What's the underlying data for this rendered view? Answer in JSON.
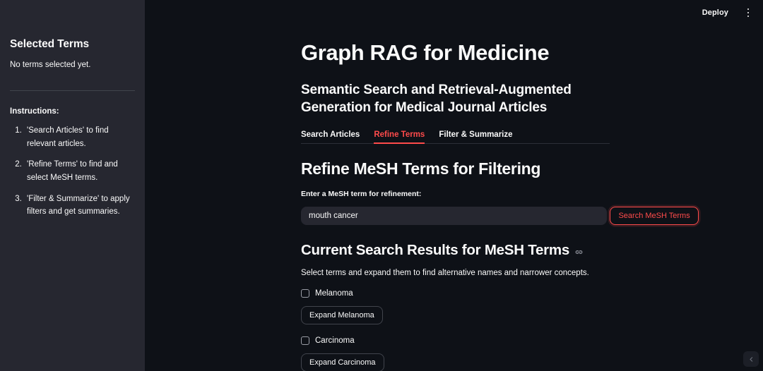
{
  "toolbar": {
    "deploy_label": "Deploy",
    "menu_icon": "kebab-menu-icon"
  },
  "sidebar": {
    "title": "Selected Terms",
    "empty_state": "No terms selected yet.",
    "instructions_title": "Instructions:",
    "instructions": [
      "'Search Articles' to find relevant articles.",
      "'Refine Terms' to find and select MeSH terms.",
      "'Filter & Summarize' to apply filters and get summaries."
    ]
  },
  "main": {
    "title": "Graph RAG for Medicine",
    "subtitle": "Semantic Search and Retrieval-Augmented Generation for Medical Journal Articles",
    "tabs": [
      {
        "label": "Search Articles",
        "active": false
      },
      {
        "label": "Refine Terms",
        "active": true
      },
      {
        "label": "Filter & Summarize",
        "active": false
      }
    ],
    "section_title": "Refine MeSH Terms for Filtering",
    "input_label": "Enter a MeSH term for refinement:",
    "input_value": "mouth cancer",
    "input_placeholder": "",
    "search_button": "Search MeSH Terms",
    "results_title": "Current Search Results for MeSH Terms",
    "results_anchor_icon": "link-icon",
    "results_description": "Select terms and expand them to find alternative names and narrower concepts.",
    "terms": [
      {
        "label": "Melanoma",
        "checked": false,
        "expand_label": "Expand Melanoma"
      },
      {
        "label": "Carcinoma",
        "checked": false,
        "expand_label": "Expand Carcinoma"
      }
    ]
  },
  "collapse_control": {
    "icon": "chevron-left-icon"
  },
  "colors": {
    "accent": "#ff4b4b",
    "background": "#0e1117",
    "sidebar_background": "#262730",
    "text": "#fafafa",
    "border": "#41444c"
  }
}
